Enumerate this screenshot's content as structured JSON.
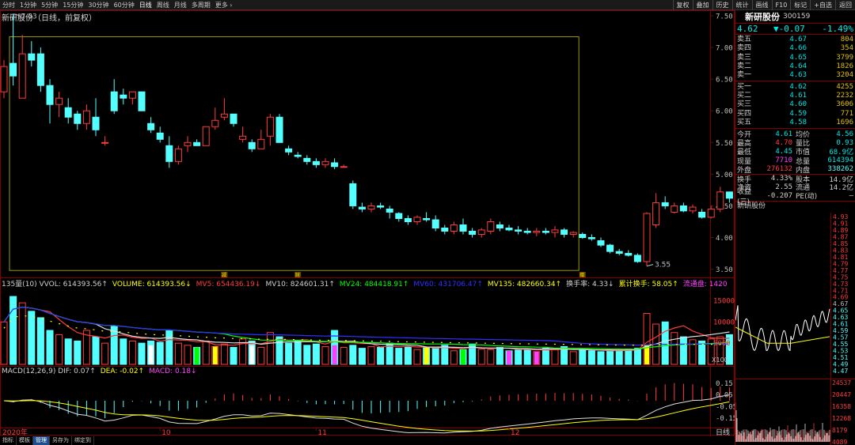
{
  "toolbar": {
    "periods": [
      {
        "label": "分时"
      },
      {
        "label": "1分钟"
      },
      {
        "label": "5分钟"
      },
      {
        "label": "15分钟"
      },
      {
        "label": "30分钟"
      },
      {
        "label": "60分钟"
      },
      {
        "label": "日线",
        "active": true
      },
      {
        "label": "周线"
      },
      {
        "label": "月线"
      },
      {
        "label": "多周期"
      }
    ],
    "more_label": "更多",
    "more_arrow": "›",
    "buttons": [
      {
        "label": "复权"
      },
      {
        "label": "叠加"
      },
      {
        "label": "历史"
      },
      {
        "label": "统计"
      },
      {
        "label": "画线"
      },
      {
        "label": "F10"
      },
      {
        "label": "标记"
      },
      {
        "label": "+自选"
      },
      {
        "label": "返回"
      }
    ]
  },
  "chart_title": "新研股份（日线，前复权）",
  "colors": {
    "up": "#ff3b3b",
    "down": "#54ffff",
    "frame": "#800000",
    "yellow": "#ffff00",
    "white": "#ffffff",
    "green": "#00ff00",
    "blue": "#3030ff",
    "magenta": "#ff40ff"
  },
  "price_axis": {
    "ticks": [
      "7.50",
      "7.00",
      "6.50",
      "6.00",
      "5.50",
      "5.00",
      "4.50",
      "4.00",
      "3.50"
    ],
    "high_label": "7.53",
    "low_label": "3.55",
    "ylim": [
      3.42,
      7.55
    ]
  },
  "time_axis": {
    "labels": [
      "2020年",
      "10",
      "11",
      "12"
    ],
    "markers": [
      "减",
      "财",
      "赠"
    ]
  },
  "volume_legend": [
    {
      "text": "135量(10) VVOL: 614393.56↑",
      "color": "#d0d0d0"
    },
    {
      "text": "VOLUME: 614393.56↓",
      "color": "#ffff00"
    },
    {
      "text": "MV5: 654436.19↓",
      "color": "#ff3b3b"
    },
    {
      "text": "MV10: 824601.31↑",
      "color": "#d0d0d0"
    },
    {
      "text": "MV24: 484418.91↑",
      "color": "#00ff00"
    },
    {
      "text": "MV60: 431706.47↑",
      "color": "#3030ff"
    },
    {
      "text": "MV135: 482660.34↑",
      "color": "#ffff00"
    },
    {
      "text": "换手率: 4.33↓",
      "color": "#d0d0d0"
    },
    {
      "text": "累计换手: 58.05↑",
      "color": "#ffff00"
    },
    {
      "text": "流通盘: 1420",
      "color": "#ff40ff"
    }
  ],
  "volume_axis": {
    "ticks": [
      "15000",
      "10000",
      "5000"
    ],
    "unit": "X100"
  },
  "macd_legend": [
    {
      "text": "MACD(12,26,9) DIF: 0.07↑",
      "color": "#d0d0d0"
    },
    {
      "text": "DEA: -0.02↑",
      "color": "#ffff00"
    },
    {
      "text": "MACD: 0.18↓",
      "color": "#ff40ff"
    }
  ],
  "macd_axis": {
    "ticks": [
      "0.15",
      "0.05",
      "-0.05",
      "-0.15"
    ]
  },
  "chart_data": {
    "type": "candlestick",
    "ohlc": [
      [
        6.3,
        6.8,
        6.2,
        6.7
      ],
      [
        6.75,
        7.53,
        6.4,
        6.55
      ],
      [
        6.2,
        7.2,
        6.3,
        6.9
      ],
      [
        6.9,
        7.1,
        6.7,
        6.8
      ],
      [
        6.9,
        7.0,
        6.3,
        6.4
      ],
      [
        6.4,
        6.5,
        5.8,
        6.1
      ],
      [
        6.1,
        6.3,
        5.9,
        6.2
      ],
      [
        6.05,
        6.2,
        5.8,
        5.9
      ],
      [
        5.95,
        6.0,
        5.7,
        5.8
      ],
      [
        5.8,
        6.1,
        5.7,
        6.0
      ],
      [
        5.9,
        6.2,
        5.6,
        5.7
      ],
      [
        5.5,
        5.6,
        5.45,
        5.5
      ],
      [
        6.3,
        6.5,
        5.95,
        6.0
      ],
      [
        6.25,
        6.35,
        6.1,
        6.2
      ],
      [
        6.2,
        6.3,
        6.1,
        6.3
      ],
      [
        6.3,
        6.3,
        6.0,
        6.0
      ],
      [
        5.8,
        5.9,
        5.65,
        5.7
      ],
      [
        5.65,
        5.75,
        5.5,
        5.55
      ],
      [
        5.45,
        5.6,
        5.1,
        5.2
      ],
      [
        5.2,
        5.45,
        5.15,
        5.4
      ],
      [
        5.45,
        5.6,
        5.35,
        5.5
      ],
      [
        5.5,
        5.55,
        5.45,
        5.45
      ],
      [
        5.45,
        5.75,
        5.45,
        5.75
      ],
      [
        5.75,
        6.05,
        5.7,
        5.85
      ],
      [
        5.9,
        6.2,
        5.85,
        5.95
      ],
      [
        5.95,
        5.9,
        5.75,
        5.8
      ],
      [
        5.55,
        5.75,
        5.5,
        5.6
      ],
      [
        5.5,
        5.55,
        5.35,
        5.4
      ],
      [
        5.4,
        5.7,
        5.4,
        5.55
      ],
      [
        5.6,
        5.95,
        5.45,
        5.9
      ],
      [
        5.9,
        5.95,
        5.5,
        5.5
      ],
      [
        5.4,
        5.45,
        5.3,
        5.35
      ],
      [
        5.3,
        5.35,
        5.25,
        5.28
      ],
      [
        5.25,
        5.3,
        5.15,
        5.2
      ],
      [
        5.2,
        5.25,
        5.1,
        5.15
      ],
      [
        5.15,
        5.25,
        5.1,
        5.2
      ],
      [
        5.18,
        5.25,
        5.08,
        5.12
      ],
      [
        5.12,
        5.15,
        5.1,
        5.12
      ],
      [
        4.85,
        4.9,
        4.45,
        4.5
      ],
      [
        4.48,
        4.55,
        4.4,
        4.45
      ],
      [
        4.45,
        4.55,
        4.4,
        4.5
      ],
      [
        4.5,
        4.55,
        4.45,
        4.48
      ],
      [
        4.45,
        4.5,
        4.3,
        4.4
      ],
      [
        4.38,
        4.4,
        4.25,
        4.3
      ],
      [
        4.3,
        4.35,
        4.2,
        4.25
      ],
      [
        4.25,
        4.35,
        4.2,
        4.32
      ],
      [
        4.3,
        4.4,
        4.25,
        4.28
      ],
      [
        4.28,
        4.35,
        4.1,
        4.15
      ],
      [
        4.15,
        4.2,
        4.05,
        4.1
      ],
      [
        4.1,
        4.25,
        4.05,
        4.2
      ],
      [
        4.2,
        4.3,
        4.05,
        4.1
      ],
      [
        4.1,
        4.15,
        4.0,
        4.05
      ],
      [
        4.05,
        4.15,
        4.0,
        4.12
      ],
      [
        4.1,
        4.3,
        4.05,
        4.25
      ],
      [
        4.2,
        4.25,
        4.1,
        4.15
      ],
      [
        4.15,
        4.2,
        4.1,
        4.12
      ],
      [
        4.12,
        4.18,
        4.05,
        4.1
      ],
      [
        4.1,
        4.15,
        4.05,
        4.08
      ],
      [
        4.08,
        4.15,
        4.02,
        4.1
      ],
      [
        4.1,
        4.15,
        4.05,
        4.08
      ],
      [
        4.08,
        4.18,
        4.0,
        4.12
      ],
      [
        4.12,
        4.15,
        4.0,
        4.05
      ],
      [
        4.05,
        4.1,
        4.0,
        4.08
      ],
      [
        4.05,
        4.08,
        3.98,
        4.0
      ],
      [
        4.0,
        4.05,
        3.95,
        3.98
      ],
      [
        3.95,
        4.0,
        3.85,
        3.88
      ],
      [
        3.88,
        3.9,
        3.75,
        3.78
      ],
      [
        3.78,
        3.82,
        3.72,
        3.75
      ],
      [
        3.75,
        3.8,
        3.7,
        3.72
      ],
      [
        3.72,
        3.75,
        3.6,
        3.62
      ],
      [
        3.62,
        4.4,
        3.55,
        4.38
      ],
      [
        4.2,
        4.7,
        4.15,
        4.55
      ],
      [
        4.55,
        4.65,
        4.45,
        4.5
      ],
      [
        4.4,
        4.55,
        4.38,
        4.5
      ],
      [
        4.5,
        4.55,
        4.4,
        4.42
      ],
      [
        4.42,
        4.52,
        4.38,
        4.48
      ],
      [
        4.4,
        4.45,
        4.3,
        4.32
      ],
      [
        4.32,
        4.5,
        4.3,
        4.45
      ],
      [
        4.45,
        4.8,
        4.4,
        4.72
      ],
      [
        4.72,
        4.68,
        4.55,
        4.62
      ]
    ],
    "volume": [
      10000,
      16000,
      14500,
      12500,
      11000,
      8000,
      7000,
      6000,
      5500,
      8000,
      6500,
      5000,
      9000,
      6000,
      5500,
      5000,
      5500,
      5200,
      8000,
      5000,
      4500,
      4000,
      5500,
      4200,
      4800,
      4000,
      6000,
      5500,
      4000,
      7500,
      6500,
      5000,
      5500,
      4500,
      4800,
      4200,
      8000,
      4000,
      4500,
      3800,
      4200,
      4000,
      5000,
      3800,
      4200,
      3500,
      4000,
      3800,
      4500,
      3200,
      3500,
      4800,
      3600,
      3500,
      4000,
      3200,
      3400,
      3600,
      3000,
      3800,
      3500,
      4200,
      3000,
      3400,
      3200,
      3000,
      3400,
      3200,
      3600,
      3800,
      12000,
      9500,
      10000,
      7500,
      6500,
      5800,
      5500,
      6000,
      6500,
      7000
    ],
    "mini_axis": [
      "4.93",
      "4.91",
      "4.89",
      "4.87",
      "4.85",
      "4.83",
      "4.81",
      "4.79",
      "4.77",
      "4.75",
      "4.73",
      "4.71",
      "4.69",
      "4.67",
      "4.65",
      "4.63",
      "4.61",
      "4.59",
      "4.57",
      "4.55",
      "4.53",
      "4.51",
      "4.49",
      "4.47"
    ],
    "mini_vol_axis": [
      "24537",
      "20447",
      "16358",
      "12268",
      "8179",
      "4089"
    ]
  },
  "side": {
    "name": "新研股份",
    "code": "300159",
    "price": "4.62",
    "change": "▼-0.07",
    "pct": "-1.49%",
    "asks": [
      {
        "label": "卖五",
        "price": "4.67",
        "vol": "804"
      },
      {
        "label": "卖四",
        "price": "4.66",
        "vol": "354"
      },
      {
        "label": "卖三",
        "price": "4.65",
        "vol": "3799"
      },
      {
        "label": "卖二",
        "price": "4.64",
        "vol": "1826"
      },
      {
        "label": "卖一",
        "price": "4.63",
        "vol": "3204"
      }
    ],
    "bids": [
      {
        "label": "买一",
        "price": "4.62",
        "vol": "4255"
      },
      {
        "label": "买二",
        "price": "4.61",
        "vol": "2232"
      },
      {
        "label": "买三",
        "price": "4.60",
        "vol": "3606"
      },
      {
        "label": "买四",
        "price": "4.59",
        "vol": "771"
      },
      {
        "label": "买五",
        "price": "4.58",
        "vol": "1696"
      }
    ],
    "stats": [
      {
        "l": "今开",
        "lv": "4.61",
        "r": "均价",
        "rv": "4.56"
      },
      {
        "l": "最高",
        "lv": "4.70",
        "r": "量比",
        "rv": "0.93"
      },
      {
        "l": "最低",
        "lv": "4.45",
        "r": "市值",
        "rv": "68.9亿"
      },
      {
        "l": "现量",
        "lv": "7710",
        "r": "总量",
        "rv": "614394"
      },
      {
        "l": "外盘",
        "lv": "276132",
        "r": "内盘",
        "rv": "338262"
      },
      {
        "l": "换手",
        "lv": "4.33%",
        "r": "股本",
        "rv": "14.9亿",
        "sep": true
      },
      {
        "l": "净资",
        "lv": "2.55",
        "r": "流通",
        "rv": "14.2亿"
      },
      {
        "l": "收益(三)",
        "lv": "-0.207",
        "r": "PE(动)",
        "rv": "—"
      }
    ],
    "mini_title": "新研股份"
  },
  "bottom_tabs": [
    {
      "label": "指标"
    },
    {
      "label": "模板"
    },
    {
      "label": "管理",
      "active": true
    },
    {
      "label": "另存为"
    },
    {
      "label": "绑定到"
    }
  ],
  "day_label": "日线"
}
